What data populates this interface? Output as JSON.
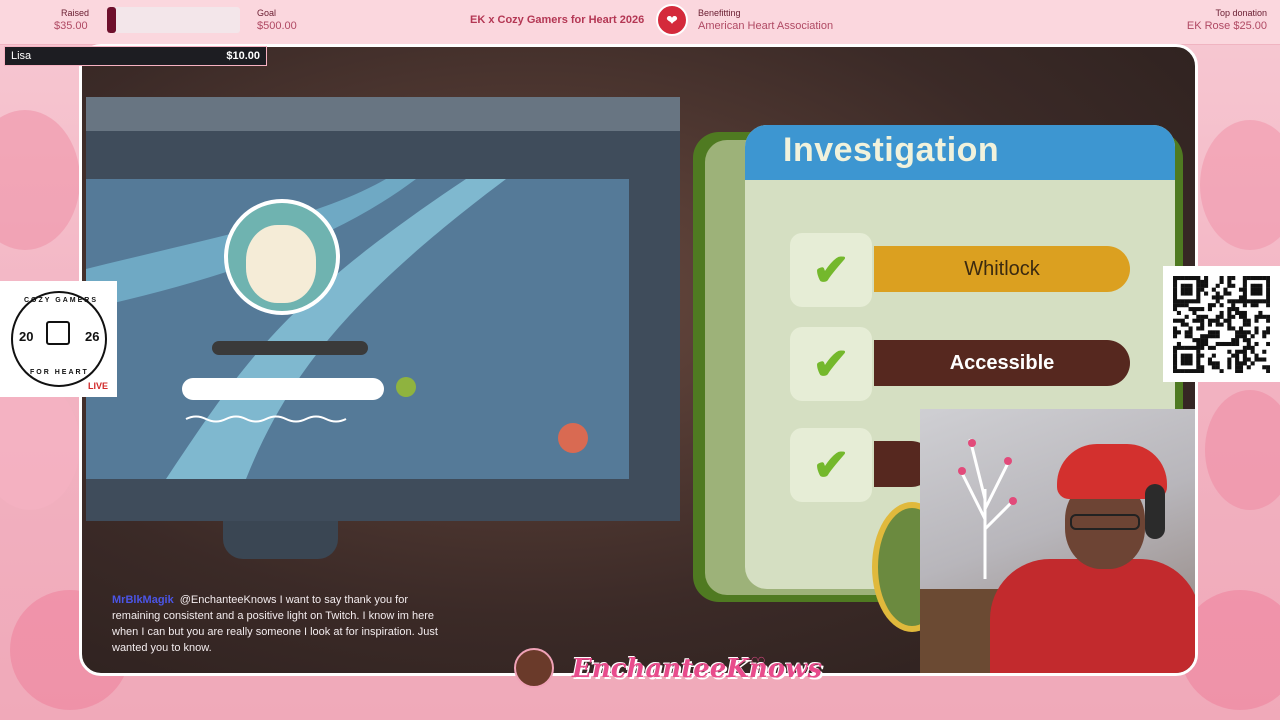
{
  "topbar": {
    "raised_label": "Raised",
    "raised_value": "$35.00",
    "goal_label": "Goal",
    "goal_value": "$500.00",
    "progress_fraction": 0.07,
    "event_title": "EK x Cozy Gamers for Heart 2026",
    "benefitting_label": "Benefitting",
    "benefitting_value": "American Heart Association",
    "top_donation_label": "Top donation",
    "top_donation_value": "EK Rose $25.00"
  },
  "donor_alert": {
    "name": "Lisa",
    "amount": "$10.00"
  },
  "game": {
    "panel_title": "Investigation",
    "items": [
      {
        "label": "Whitlock",
        "checked": true
      },
      {
        "label": "Accessible",
        "checked": true
      },
      {
        "label": "",
        "checked": true
      }
    ]
  },
  "chat": {
    "username": "MrBlkMagik",
    "message": "@EnchanteeKnows I want to say thank you for remaining consistent and a positive light on Twitch. I know im here when I can but you are really someone I look at for inspiration. Just wanted you to know."
  },
  "branding": {
    "streamer_name": "EnchanteeKnows",
    "sticker_top": "COZY GAMERS",
    "sticker_bottom": "FOR HEART",
    "sticker_year_left": "20",
    "sticker_year_right": "26",
    "sticker_badge": "LIVE"
  },
  "colors": {
    "accent_pink": "#e84c8c",
    "panel_header_blue": "#3d96d1",
    "check_green": "#74b82c",
    "pill_gold": "#dba020",
    "pill_brown": "#56281f"
  }
}
